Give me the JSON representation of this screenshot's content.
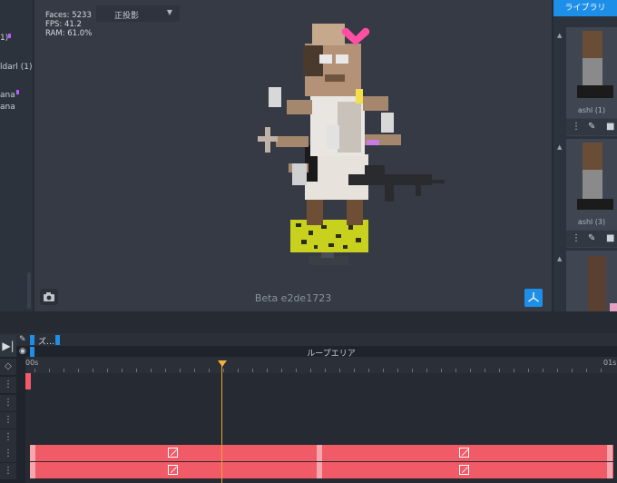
{
  "left_panel": {
    "items": [
      "1)",
      "ldarl (1)",
      "ana",
      "ana"
    ]
  },
  "viewport": {
    "stats": {
      "faces": "Faces: 5233",
      "fps": "FPS: 41.2",
      "ram": "RAM: 61.0%"
    },
    "projection": "正投影",
    "version": "Beta e2de1723",
    "colors": {
      "accent": "#1e8fe8",
      "background": "#353a45"
    }
  },
  "library": {
    "tab_label": "ライブラリ",
    "cards": [
      {
        "name": "ashl (1)"
      },
      {
        "name": "ashl (3)"
      }
    ]
  },
  "timeline": {
    "zoom_label": "ズ…",
    "loop_label": "ループエリア",
    "ruler_start": "00s",
    "ruler_end": "01s",
    "clip_color": "#f15b67",
    "playhead_color": "#f0a030"
  }
}
